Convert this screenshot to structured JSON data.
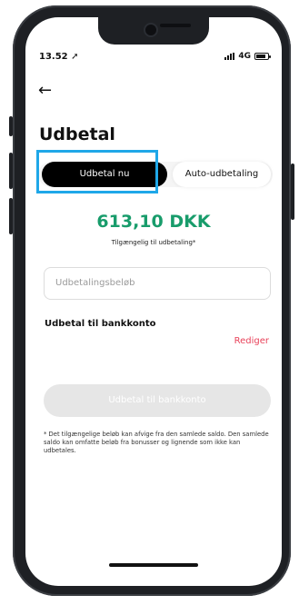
{
  "status_bar": {
    "time": "13.52",
    "network": "4G"
  },
  "header": {
    "title": "Udbetal"
  },
  "tabs": [
    {
      "label": "Udbetal nu",
      "active": true
    },
    {
      "label": "Auto-udbetaling",
      "active": false
    }
  ],
  "balance": {
    "amount": "613,10 DKK",
    "caption": "Tilgængelig til udbetaling*"
  },
  "form": {
    "amount_placeholder": "Udbetalingsbeløb"
  },
  "bank": {
    "section_title": "Udbetal til bankkonto",
    "edit_label": "Rediger"
  },
  "cta": {
    "label": "Udbetal til bankkonto",
    "enabled": false
  },
  "disclaimer": "* Det tilgængelige beløb kan afvige fra den samlede saldo. Den samlede saldo kan omfatte beløb fra bonusser og lignende som ikke kan udbetales.",
  "colors": {
    "accent_green": "#189c6b",
    "edit_red": "#e8425a",
    "highlight_blue": "#1fa7e8"
  }
}
